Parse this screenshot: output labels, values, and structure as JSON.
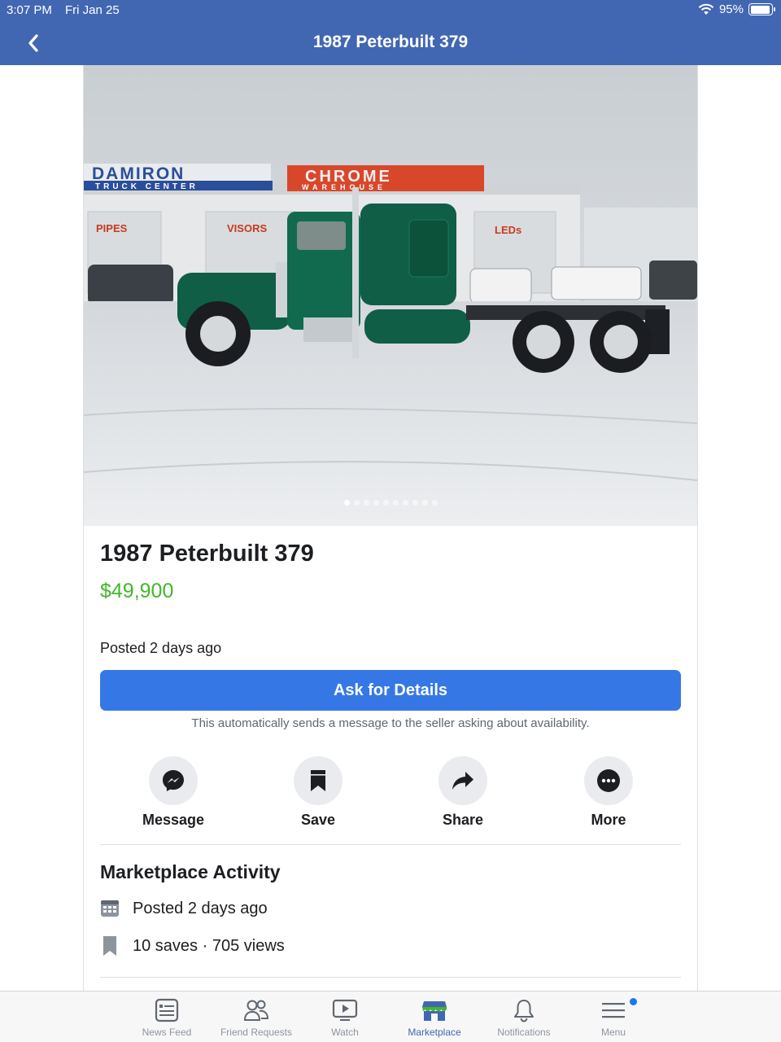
{
  "status": {
    "time": "3:07 PM",
    "date": "Fri Jan 25",
    "battery": "95%",
    "battery_level": 0.95
  },
  "header": {
    "title": "1987 Peterbuilt 379"
  },
  "photo": {
    "signs": [
      "DAMIRON",
      "TRUCK CENTER",
      "CHROME",
      "WAREHOUSE",
      "PIPES",
      "VISORS",
      "LEDs"
    ],
    "page_count": 10,
    "active_index": 0
  },
  "listing": {
    "title": "1987 Peterbuilt 379",
    "price": "$49,900",
    "posted": "Posted 2 days ago",
    "ask_button": "Ask for Details",
    "ask_note": "This automatically sends a message to the seller asking about availability."
  },
  "actions": [
    {
      "label": "Message",
      "icon": "messenger-icon"
    },
    {
      "label": "Save",
      "icon": "bookmark-icon"
    },
    {
      "label": "Share",
      "icon": "share-arrow-icon"
    },
    {
      "label": "More",
      "icon": "more-dots-icon"
    }
  ],
  "activity": {
    "title": "Marketplace Activity",
    "rows": [
      {
        "icon": "calendar-icon",
        "text": "Posted 2 days ago"
      },
      {
        "icon": "bookmark-icon",
        "text": "10 saves · 705 views"
      }
    ]
  },
  "tabs": [
    {
      "label": "News Feed",
      "icon": "news-feed-icon"
    },
    {
      "label": "Friend Requests",
      "icon": "friends-icon"
    },
    {
      "label": "Watch",
      "icon": "watch-icon"
    },
    {
      "label": "Marketplace",
      "icon": "marketplace-icon",
      "active": true
    },
    {
      "label": "Notifications",
      "icon": "bell-icon"
    },
    {
      "label": "Menu",
      "icon": "menu-icon",
      "has_badge": true
    }
  ],
  "colors": {
    "brand": "#4267b2",
    "button": "#3578e5",
    "price": "#42b72a"
  }
}
